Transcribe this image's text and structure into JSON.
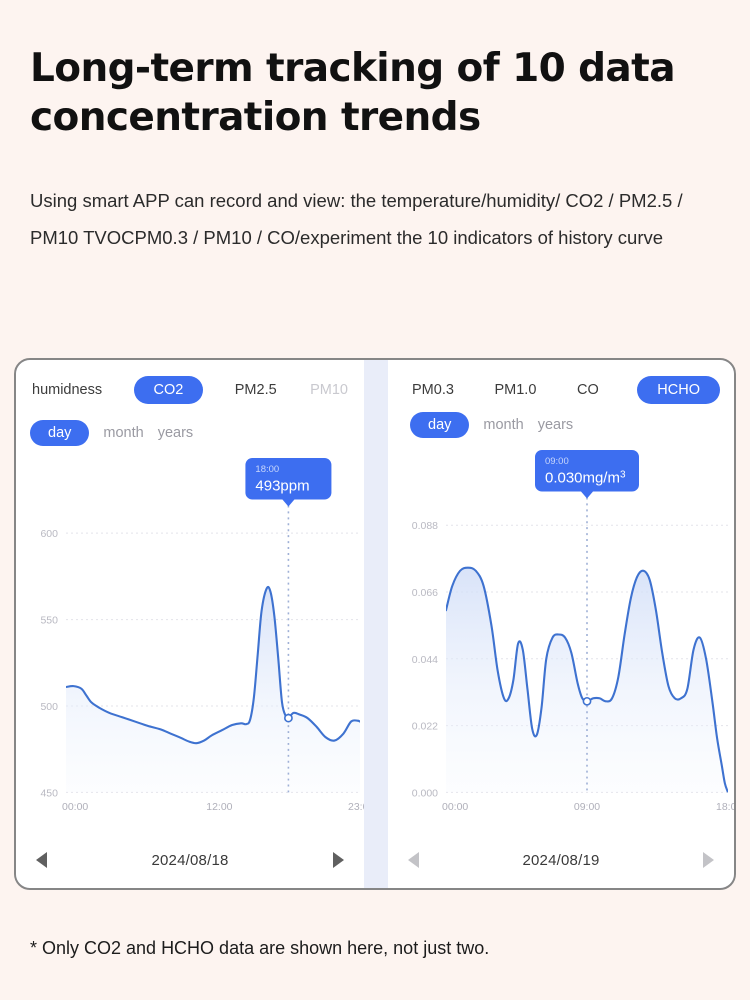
{
  "header": {
    "title": "Long-term tracking of 10 data concentration trends",
    "description": "Using smart APP can record and view: the temperature/humidity/ CO2 / PM2.5 / PM10 TVOCPM0.3 / PM10 / CO/experiment the 10 indicators of history curve"
  },
  "footnote": "* Only CO2 and HCHO data are shown here, not just two.",
  "colors": {
    "accent": "#3d6ef0",
    "page_background": "#fdf4f0",
    "panel_background": "#ffffff",
    "gap_background": "#e9edf9",
    "line": "#3e72d0",
    "muted_text": "#c9c9cf"
  },
  "left_panel": {
    "tabs": [
      {
        "label": "humidness",
        "active": false,
        "muted": false
      },
      {
        "label": "CO2",
        "active": true,
        "muted": false
      },
      {
        "label": "PM2.5",
        "active": false,
        "muted": false
      },
      {
        "label": "PM10",
        "active": false,
        "muted": true
      }
    ],
    "periods": [
      {
        "label": "day",
        "active": true
      },
      {
        "label": "month",
        "active": false
      },
      {
        "label": "years",
        "active": false
      }
    ],
    "date": "2024/08/18",
    "prev_arrow": "triangle-left-icon",
    "next_arrow": "triangle-right-icon"
  },
  "right_panel": {
    "tabs": [
      {
        "label": "PM0.3",
        "active": false,
        "muted": false
      },
      {
        "label": "PM1.0",
        "active": false,
        "muted": false
      },
      {
        "label": "CO",
        "active": false,
        "muted": false
      },
      {
        "label": "HCHO",
        "active": true,
        "muted": false
      }
    ],
    "periods": [
      {
        "label": "day",
        "active": true
      },
      {
        "label": "month",
        "active": false
      },
      {
        "label": "years",
        "active": false
      }
    ],
    "date": "2024/08/19",
    "prev_arrow": "triangle-left-icon",
    "next_arrow": "triangle-right-icon"
  },
  "chart_data": [
    {
      "id": "co2-day-chart",
      "type": "area",
      "title": "CO2",
      "xlabel": "",
      "ylabel": "ppm",
      "unit": "ppm",
      "ylim": [
        450,
        600
      ],
      "yticks": [
        "600",
        "550",
        "500",
        "450"
      ],
      "ytick_values": [
        600,
        550,
        500,
        450
      ],
      "xticks": [
        "00:00",
        "12:00",
        "23:0"
      ],
      "xtick_positions": [
        0,
        12,
        23
      ],
      "grid": true,
      "legend": "none",
      "tooltip": {
        "time": "18:00",
        "value": "493ppm",
        "x_hour": 17.4,
        "y_value": 493
      },
      "x": [
        0.0,
        0.6,
        1.2,
        1.6,
        2.0,
        2.6,
        3.4,
        4.4,
        5.4,
        6.4,
        7.4,
        8.2,
        9.0,
        9.6,
        10.2,
        10.8,
        11.4,
        12.2,
        13.0,
        13.7,
        14.1,
        14.4,
        14.7,
        15.0,
        15.3,
        15.7,
        16.0,
        16.3,
        16.6,
        16.9,
        17.2,
        17.4,
        17.8,
        18.3,
        18.9,
        19.6,
        20.3,
        21.0,
        21.7,
        22.3,
        22.8,
        23.0
      ],
      "y": [
        511,
        511.5,
        510,
        506,
        502,
        499,
        496,
        493.5,
        491,
        488.5,
        486.5,
        484,
        481.5,
        479.5,
        478.5,
        480,
        483,
        486,
        489,
        490,
        489.5,
        492,
        505,
        530,
        555,
        568,
        566,
        552,
        528,
        502,
        494,
        493,
        496,
        495,
        493,
        488,
        482,
        480,
        484,
        491,
        491.5,
        491
      ]
    },
    {
      "id": "hcho-day-chart",
      "type": "area",
      "title": "HCHO",
      "xlabel": "",
      "ylabel": "mg/m³",
      "unit": "mg/m³",
      "ylim": [
        0.0,
        0.088
      ],
      "yticks": [
        "0.088",
        "0.066",
        "0.044",
        "0.022",
        "0.000"
      ],
      "ytick_values": [
        0.088,
        0.066,
        0.044,
        0.022,
        0.0
      ],
      "xticks": [
        "00:00",
        "09:00",
        "18:0"
      ],
      "xtick_positions": [
        0,
        9,
        18
      ],
      "grid": true,
      "legend": "none",
      "tooltip": {
        "time": "09:00",
        "value": "0.030mg/m³",
        "x_hour": 9.0,
        "y_value": 0.03
      },
      "x": [
        0.0,
        0.4,
        0.9,
        1.4,
        1.9,
        2.4,
        2.9,
        3.3,
        3.7,
        4.0,
        4.3,
        4.6,
        4.9,
        5.2,
        5.5,
        5.8,
        6.1,
        6.4,
        6.8,
        7.2,
        7.6,
        8.0,
        8.4,
        8.7,
        9.0,
        9.4,
        9.8,
        10.2,
        10.6,
        11.0,
        11.4,
        11.8,
        12.2,
        12.6,
        13.0,
        13.4,
        13.8,
        14.2,
        14.6,
        15.0,
        15.4,
        15.8,
        16.2,
        16.6,
        17.0,
        17.3,
        17.6,
        17.8,
        18.0
      ],
      "y": [
        0.06,
        0.068,
        0.073,
        0.074,
        0.073,
        0.068,
        0.055,
        0.04,
        0.031,
        0.031,
        0.037,
        0.049,
        0.047,
        0.034,
        0.021,
        0.019,
        0.028,
        0.044,
        0.051,
        0.052,
        0.051,
        0.046,
        0.036,
        0.031,
        0.03,
        0.031,
        0.031,
        0.03,
        0.031,
        0.038,
        0.052,
        0.064,
        0.071,
        0.073,
        0.07,
        0.06,
        0.046,
        0.035,
        0.031,
        0.031,
        0.034,
        0.047,
        0.051,
        0.044,
        0.03,
        0.018,
        0.009,
        0.003,
        0.0
      ]
    }
  ]
}
